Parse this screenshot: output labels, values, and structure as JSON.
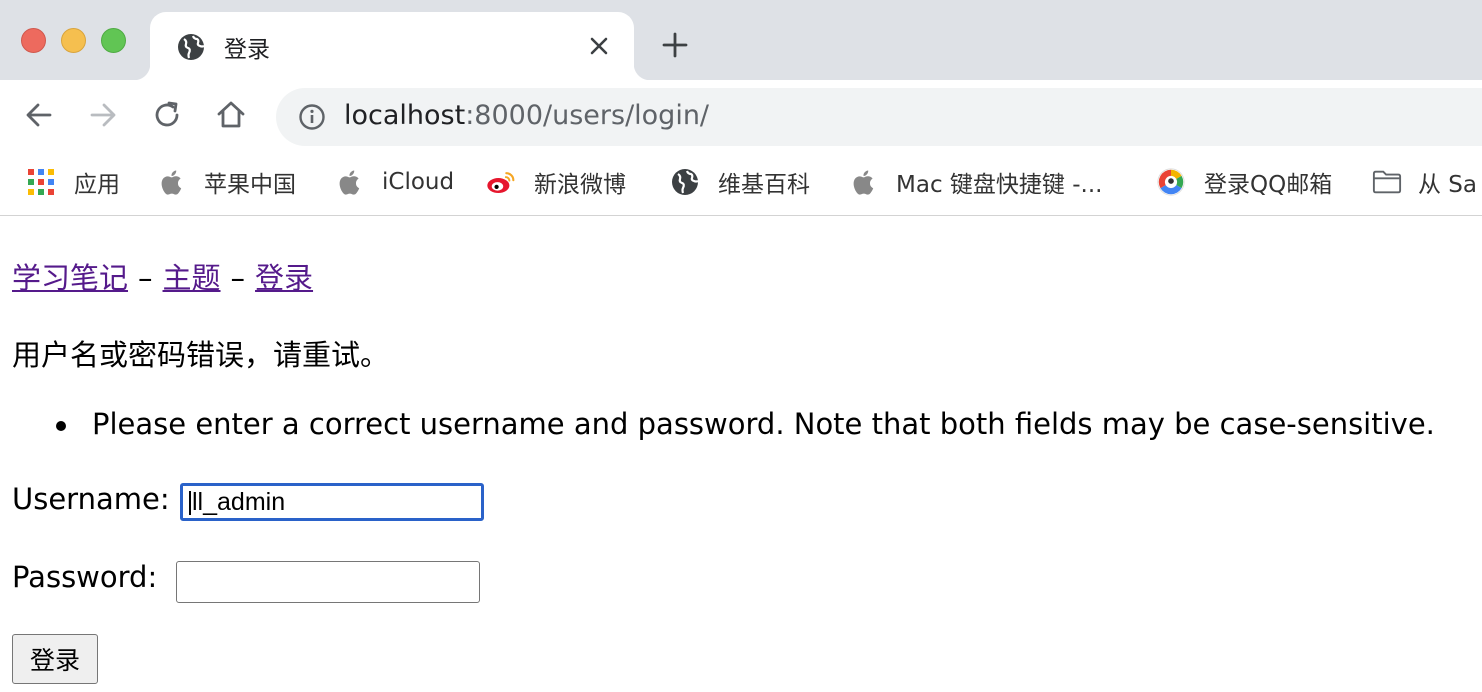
{
  "browser": {
    "tab": {
      "title": "登录"
    },
    "omnibox": {
      "host": "localhost",
      "rest": ":8000/users/login/"
    },
    "bookmarks": [
      {
        "label": "应用",
        "icon": "apps-grid-icon"
      },
      {
        "label": "苹果中国",
        "icon": "apple-icon"
      },
      {
        "label": "iCloud",
        "icon": "apple-icon"
      },
      {
        "label": "新浪微博",
        "icon": "weibo-icon"
      },
      {
        "label": "维基百科",
        "icon": "globe-icon"
      },
      {
        "label": "Mac 键盘快捷键 -...",
        "icon": "apple-icon"
      },
      {
        "label": "登录QQ邮箱",
        "icon": "qq-mail-icon"
      },
      {
        "label": "从 Sa",
        "icon": "folder-icon"
      }
    ]
  },
  "page": {
    "breadcrumb": {
      "home": "学习笔记",
      "topics": "主题",
      "login": "登录",
      "separator": "–"
    },
    "error_message": "用户名或密码错误，请重试。",
    "error_list": [
      "Please enter a correct username and password. Note that both fields may be case-sensitive."
    ],
    "form": {
      "username_label": "Username:",
      "username_value": "ll_admin",
      "password_label": "Password:",
      "password_value": "",
      "submit_label": "登录"
    }
  }
}
